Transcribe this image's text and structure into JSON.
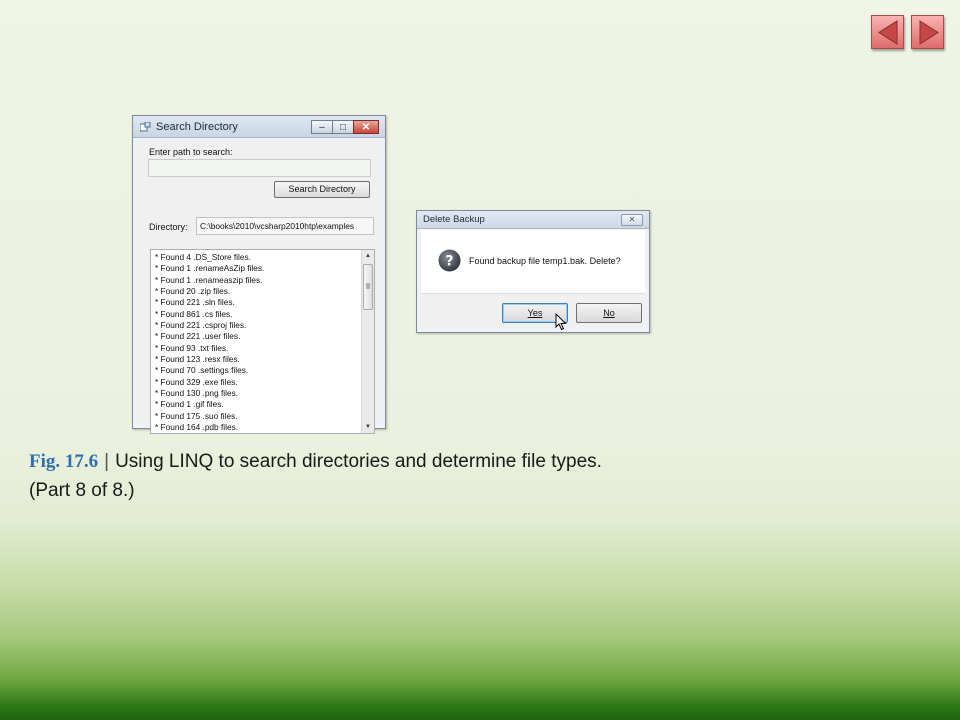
{
  "nav": {
    "prev_icon": "triangle-left-icon",
    "next_icon": "triangle-right-icon",
    "color": "#e06c6c"
  },
  "search_window": {
    "title": "Search Directory",
    "controls": {
      "minimize": "–",
      "maximize": "□",
      "close": "✕"
    },
    "path_label": "Enter path to search:",
    "path_value": "",
    "search_button": "Search Directory",
    "directory_label": "Directory:",
    "directory_value": "C:\\books\\2010\\vcsharp2010htp\\examples",
    "results": [
      "* Found 4 .DS_Store files.",
      "* Found 1 .renameAsZip files.",
      "* Found 1 .renameaszip files.",
      "* Found 20 .zip files.",
      "* Found 221 .sln files.",
      "* Found 861 .cs files.",
      "* Found 221 .csproj files.",
      "* Found 221 .user files.",
      "* Found 93 .txt files.",
      "* Found 123 .resx files.",
      "* Found 70 .settings files.",
      "* Found 329 .exe files.",
      "* Found 130 .png files.",
      "* Found 1 .gif files.",
      "* Found 175 .suo files.",
      "* Found 164 .pdb files."
    ]
  },
  "delete_dialog": {
    "title": "Delete Backup",
    "close": "✕",
    "icon": "question-icon",
    "message": "Found backup file temp1.bak. Delete?",
    "yes_label": "Yes",
    "no_label": "No"
  },
  "caption": {
    "figure": "Fig. 17.6",
    "separator": "|",
    "text": "Using LINQ to search directories and determine file types.",
    "part": "(Part 8 of 8.)"
  }
}
